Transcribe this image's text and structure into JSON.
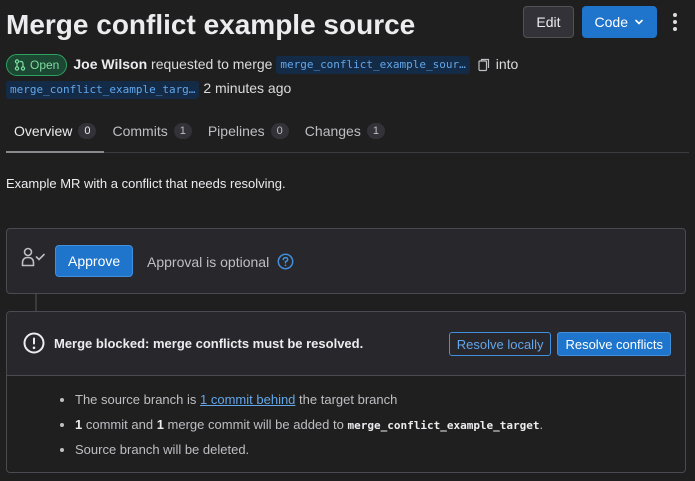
{
  "header": {
    "title": "Merge conflict example source",
    "edit_label": "Edit",
    "code_label": "Code"
  },
  "meta": {
    "status": "Open",
    "author": "Joe Wilson",
    "requested_text": "requested to merge",
    "source_branch": "merge_conflict_example_sour…",
    "into_text": "into",
    "target_branch": "merge_conflict_example_targ…",
    "time_ago": "2 minutes ago"
  },
  "tabs": [
    {
      "label": "Overview",
      "count": "0"
    },
    {
      "label": "Commits",
      "count": "1"
    },
    {
      "label": "Pipelines",
      "count": "0"
    },
    {
      "label": "Changes",
      "count": "1"
    }
  ],
  "description": "Example MR with a conflict that needs resolving.",
  "approval": {
    "approve_label": "Approve",
    "optional_text": "Approval is optional"
  },
  "merge": {
    "blocked_text": "Merge blocked: merge conflicts must be resolved.",
    "resolve_locally_label": "Resolve locally",
    "resolve_conflicts_label": "Resolve conflicts",
    "line1_prefix": "The source branch is",
    "line1_link": "1 commit behind",
    "line1_suffix": "the target branch",
    "line2_count1": "1",
    "line2_mid1": "commit and",
    "line2_count2": "1",
    "line2_mid2": "merge commit will be added to",
    "line2_branch": "merge_conflict_example_target",
    "line2_end": ".",
    "line3": "Source branch will be deleted."
  },
  "colors": {
    "background": "#1f1f1f",
    "accent": "#1f75cb",
    "status_open": "#2da160",
    "link": "#63a6e9"
  },
  "icons": [
    "merge-request-icon",
    "copy-icon",
    "chevron-down-icon",
    "kebab-icon",
    "approval-user-icon",
    "help-icon",
    "alert-circle-icon"
  ]
}
